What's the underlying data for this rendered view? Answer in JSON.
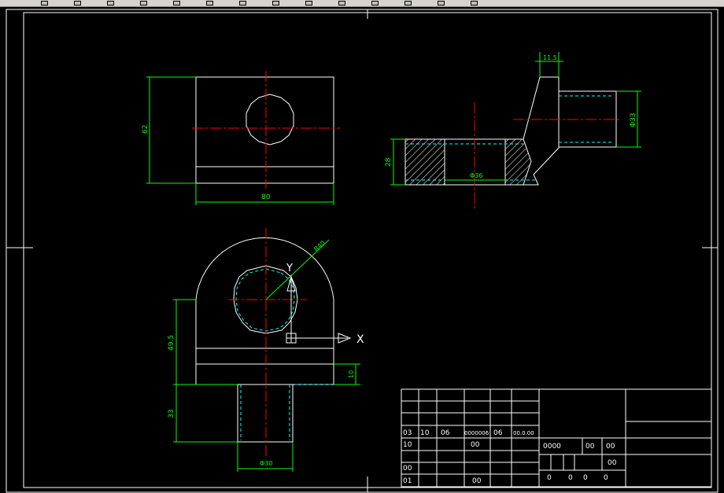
{
  "app": {
    "name": "CAD drawing viewport"
  },
  "toolbar": {
    "icons": [
      "new-icon",
      "open-icon",
      "save-icon",
      "print-icon",
      "undo-icon",
      "redo-icon",
      "pan-icon",
      "zoom-icon",
      "layer-icon",
      "properties-icon",
      "snap-icon",
      "grid-icon",
      "ortho-icon",
      "help-icon"
    ]
  },
  "colors": {
    "background": "#000000",
    "geometry": "#ffffff",
    "dimension": "#00ff00",
    "centerline": "#ff0000",
    "hidden": "#00ffff",
    "ucs": "#ffffff"
  },
  "dims": {
    "front_height": "62",
    "front_width": "80",
    "side_thickness": "11.5",
    "side_diameter": "Φ33",
    "side_height": "28",
    "side_bore": "Φ36",
    "top_radius": "R40",
    "top_offset": "49.5",
    "top_boss_offset": "10",
    "top_boss_height": "33",
    "top_boss_diameter": "Φ30"
  },
  "ucs": {
    "x_label": "X",
    "y_label": "Y"
  },
  "titleblock": {
    "row_a": [
      "03",
      "10",
      "06",
      "0000006",
      "06",
      "00.0.00"
    ],
    "row_b": [
      "10",
      "00",
      "0000",
      "00",
      "00"
    ],
    "row_c": [
      "00",
      "00"
    ],
    "row_d": [
      "01",
      "00",
      "0",
      "0",
      "0",
      "0"
    ]
  }
}
